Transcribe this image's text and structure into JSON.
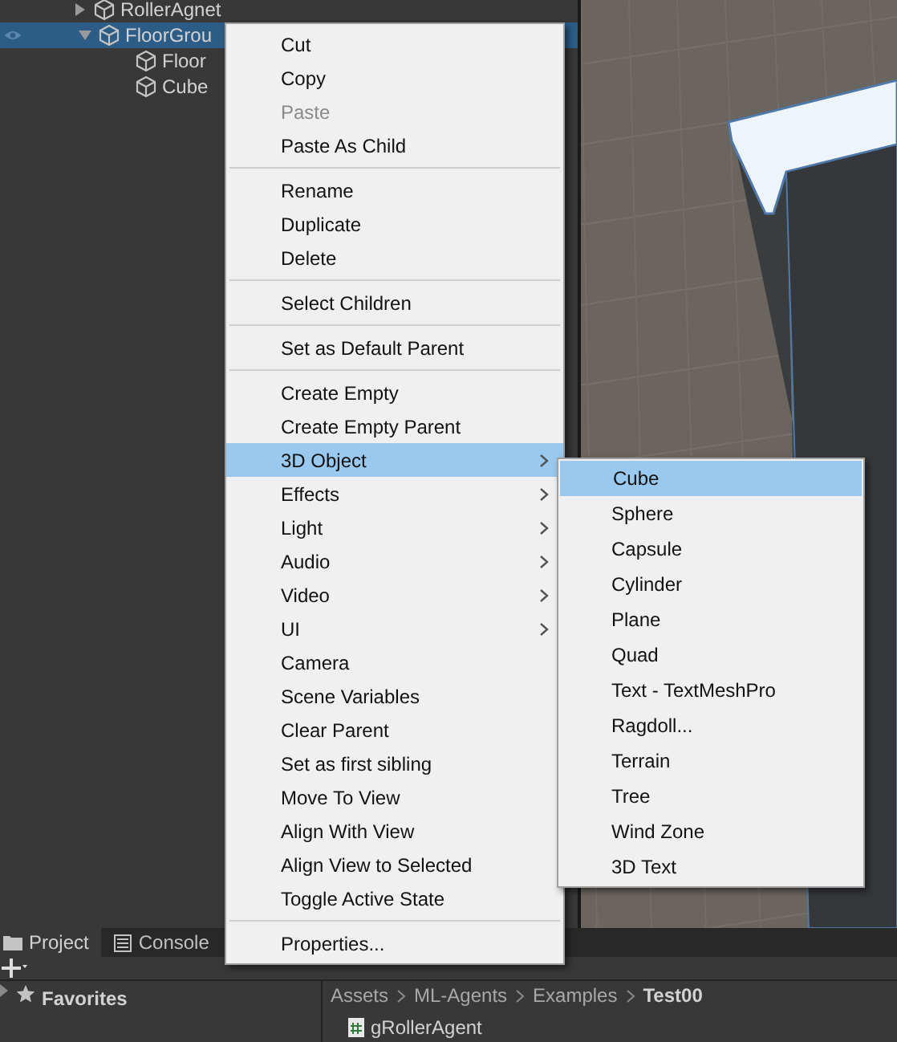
{
  "hierarchy": {
    "items": [
      {
        "label": "RollerAgnet",
        "selected": false,
        "expanded": false
      },
      {
        "label": "FloorGrou",
        "selected": true,
        "expanded": true,
        "children": [
          {
            "label": "Floor",
            "selected": false
          },
          {
            "label": "Cube",
            "selected": false
          }
        ]
      }
    ]
  },
  "project_panel": {
    "tabs": [
      {
        "label": "Project",
        "selected": true
      },
      {
        "label": "Console",
        "selected": false
      }
    ],
    "favorites": "Favorites",
    "breadcrumb": [
      "Assets",
      "ML-Agents",
      "Examples",
      "Test00"
    ],
    "files": [
      "gRollerAgent"
    ]
  },
  "context_menu": {
    "groups": [
      [
        {
          "label": "Cut",
          "disabled": false,
          "submenu": false,
          "highlighted": false
        },
        {
          "label": "Copy",
          "disabled": false,
          "submenu": false,
          "highlighted": false
        },
        {
          "label": "Paste",
          "disabled": true,
          "submenu": false,
          "highlighted": false
        },
        {
          "label": "Paste As Child",
          "disabled": false,
          "submenu": false,
          "highlighted": false
        }
      ],
      [
        {
          "label": "Rename",
          "disabled": false,
          "submenu": false,
          "highlighted": false
        },
        {
          "label": "Duplicate",
          "disabled": false,
          "submenu": false,
          "highlighted": false
        },
        {
          "label": "Delete",
          "disabled": false,
          "submenu": false,
          "highlighted": false
        }
      ],
      [
        {
          "label": "Select Children",
          "disabled": false,
          "submenu": false,
          "highlighted": false
        }
      ],
      [
        {
          "label": "Set as Default Parent",
          "disabled": false,
          "submenu": false,
          "highlighted": false
        }
      ],
      [
        {
          "label": "Create Empty",
          "disabled": false,
          "submenu": false,
          "highlighted": false
        },
        {
          "label": "Create Empty Parent",
          "disabled": false,
          "submenu": false,
          "highlighted": false
        },
        {
          "label": "3D Object",
          "disabled": false,
          "submenu": true,
          "highlighted": true
        },
        {
          "label": "Effects",
          "disabled": false,
          "submenu": true,
          "highlighted": false
        },
        {
          "label": "Light",
          "disabled": false,
          "submenu": true,
          "highlighted": false
        },
        {
          "label": "Audio",
          "disabled": false,
          "submenu": true,
          "highlighted": false
        },
        {
          "label": "Video",
          "disabled": false,
          "submenu": true,
          "highlighted": false
        },
        {
          "label": "UI",
          "disabled": false,
          "submenu": true,
          "highlighted": false
        },
        {
          "label": "Camera",
          "disabled": false,
          "submenu": false,
          "highlighted": false
        },
        {
          "label": "Scene Variables",
          "disabled": false,
          "submenu": false,
          "highlighted": false
        },
        {
          "label": "Clear Parent",
          "disabled": false,
          "submenu": false,
          "highlighted": false
        },
        {
          "label": "Set as first sibling",
          "disabled": false,
          "submenu": false,
          "highlighted": false
        },
        {
          "label": "Move To View",
          "disabled": false,
          "submenu": false,
          "highlighted": false
        },
        {
          "label": "Align With View",
          "disabled": false,
          "submenu": false,
          "highlighted": false
        },
        {
          "label": "Align View to Selected",
          "disabled": false,
          "submenu": false,
          "highlighted": false
        },
        {
          "label": "Toggle Active State",
          "disabled": false,
          "submenu": false,
          "highlighted": false
        }
      ],
      [
        {
          "label": "Properties...",
          "disabled": false,
          "submenu": false,
          "highlighted": false
        }
      ]
    ]
  },
  "submenu": {
    "items": [
      {
        "label": "Cube",
        "selected": true
      },
      {
        "label": "Sphere",
        "selected": false
      },
      {
        "label": "Capsule",
        "selected": false
      },
      {
        "label": "Cylinder",
        "selected": false
      },
      {
        "label": "Plane",
        "selected": false
      },
      {
        "label": "Quad",
        "selected": false
      },
      {
        "label": "Text - TextMeshPro",
        "selected": false
      },
      {
        "label": "Ragdoll...",
        "selected": false
      },
      {
        "label": "Terrain",
        "selected": false
      },
      {
        "label": "Tree",
        "selected": false
      },
      {
        "label": "Wind Zone",
        "selected": false
      },
      {
        "label": "3D Text",
        "selected": false
      }
    ]
  }
}
